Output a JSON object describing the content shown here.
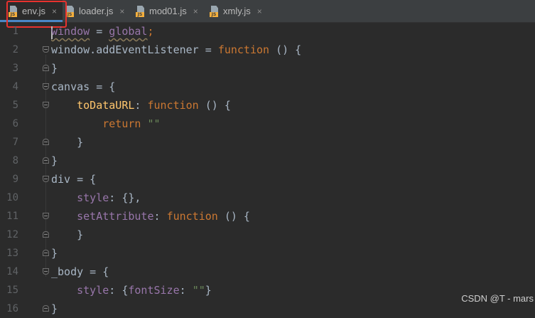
{
  "tabs": [
    {
      "label": "env.js",
      "icon": "js-file-icon",
      "badge": "JS",
      "close": "×",
      "active": true
    },
    {
      "label": "loader.js",
      "icon": "js-file-icon",
      "badge": "JS",
      "close": "×",
      "active": false
    },
    {
      "label": "mod01.js",
      "icon": "js-file-icon",
      "badge": "JS",
      "close": "×",
      "active": false
    },
    {
      "label": "xmly.js",
      "icon": "js-file-icon",
      "badge": "JS",
      "close": "×",
      "active": false
    }
  ],
  "colors": {
    "background": "#2b2b2b",
    "keyword": "#cc7832",
    "property": "#9876aa",
    "function": "#ffc66d",
    "string": "#6a8759",
    "highlight_box": "#e8322e"
  },
  "lines": [
    {
      "num": "1",
      "fold": "none",
      "tokens": [
        [
          "window",
          "glob"
        ],
        [
          " = ",
          ""
        ],
        [
          "global",
          "glob"
        ],
        [
          ";",
          "kw"
        ]
      ]
    },
    {
      "num": "2",
      "fold": "open",
      "tokens": [
        [
          "window.addEventListener = ",
          ""
        ],
        [
          "function",
          "kw"
        ],
        [
          " () {",
          ""
        ]
      ]
    },
    {
      "num": "3",
      "fold": "close",
      "tokens": [
        [
          "}",
          ""
        ]
      ]
    },
    {
      "num": "4",
      "fold": "open",
      "tokens": [
        [
          "canvas = {",
          ""
        ]
      ]
    },
    {
      "num": "5",
      "fold": "open",
      "tokens": [
        [
          "    ",
          ""
        ],
        [
          "toDataURL",
          "fn"
        ],
        [
          ": ",
          ""
        ],
        [
          "function",
          "kw"
        ],
        [
          " () {",
          ""
        ]
      ]
    },
    {
      "num": "6",
      "fold": "none",
      "tokens": [
        [
          "        ",
          ""
        ],
        [
          "return",
          "kw"
        ],
        [
          " ",
          ""
        ],
        [
          "\"\"",
          "str"
        ]
      ]
    },
    {
      "num": "7",
      "fold": "close",
      "tokens": [
        [
          "    }",
          ""
        ]
      ]
    },
    {
      "num": "8",
      "fold": "close",
      "tokens": [
        [
          "}",
          ""
        ]
      ]
    },
    {
      "num": "9",
      "fold": "open",
      "tokens": [
        [
          "div = {",
          ""
        ]
      ]
    },
    {
      "num": "10",
      "fold": "none",
      "tokens": [
        [
          "    ",
          ""
        ],
        [
          "style",
          "prop"
        ],
        [
          ": {},",
          ""
        ]
      ]
    },
    {
      "num": "11",
      "fold": "open",
      "tokens": [
        [
          "    ",
          ""
        ],
        [
          "setAttribute",
          "prop"
        ],
        [
          ": ",
          ""
        ],
        [
          "function",
          "kw"
        ],
        [
          " () {",
          ""
        ]
      ]
    },
    {
      "num": "12",
      "fold": "close",
      "tokens": [
        [
          "    }",
          ""
        ]
      ]
    },
    {
      "num": "13",
      "fold": "close",
      "tokens": [
        [
          "}",
          ""
        ]
      ]
    },
    {
      "num": "14",
      "fold": "open",
      "tokens": [
        [
          "_body = {",
          ""
        ]
      ]
    },
    {
      "num": "15",
      "fold": "none",
      "tokens": [
        [
          "    ",
          ""
        ],
        [
          "style",
          "prop"
        ],
        [
          ": {",
          ""
        ],
        [
          "fontSize",
          "prop"
        ],
        [
          ": ",
          ""
        ],
        [
          "\"\"",
          "str"
        ],
        [
          "}",
          ""
        ]
      ]
    },
    {
      "num": "16",
      "fold": "close",
      "tokens": [
        [
          "}",
          ""
        ]
      ]
    }
  ],
  "watermark": "CSDN @T - mars"
}
